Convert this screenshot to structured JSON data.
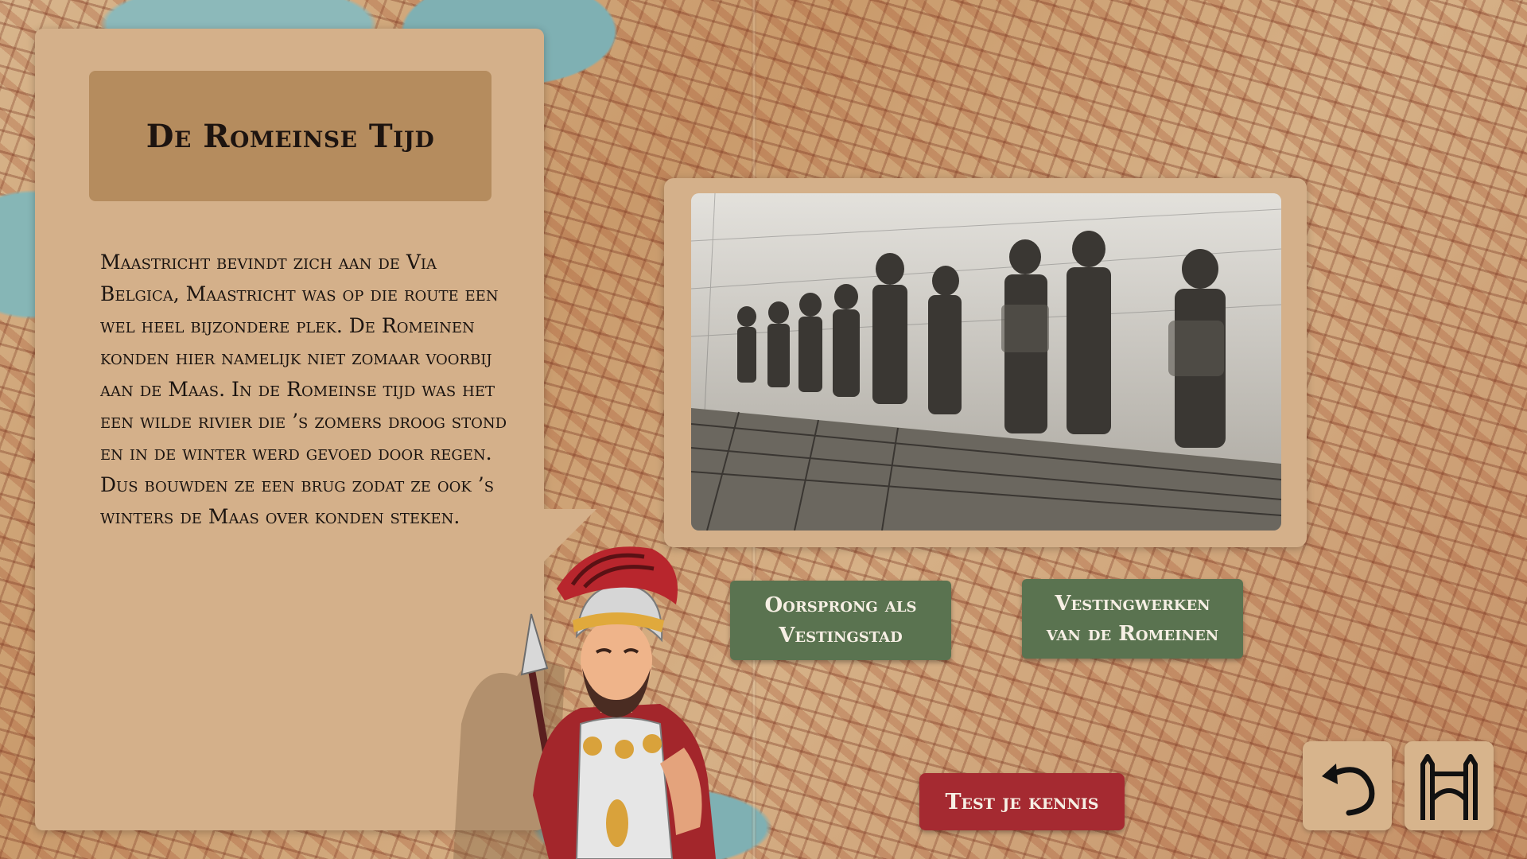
{
  "title": "De Romeinse Tijd",
  "body_text": "Maastricht bevindt zich aan de Via Belgica, Maastricht was op die route een wel heel bijzondere plek. De Romeinen konden hier namelijk niet zomaar voorbij aan de Maas. In de Romeinse tijd was het een wilde rivier die ’s zomers droog stond en in de winter werd gevoed door regen. Dus bouwden ze een brug zodat ze ook ’s winters de Maas over konden steken.",
  "buttons": {
    "origin_line1": "Oorsprong als",
    "origin_line2": "Vestingstad",
    "fort_line1": "Vestingwerken",
    "fort_line2": "van de Romeinen",
    "test": "Test je kennis"
  },
  "icons": {
    "back": "undo-arrow-icon",
    "home": "city-gate-icon",
    "background": "old-city-map",
    "illustration": "roman-soldiers-sketch",
    "character": "roman-soldier-character"
  },
  "colors": {
    "panel": "#d4b08a",
    "title_box": "#b58c5e",
    "green_button": "#5a7350",
    "red_button": "#a52a31"
  }
}
